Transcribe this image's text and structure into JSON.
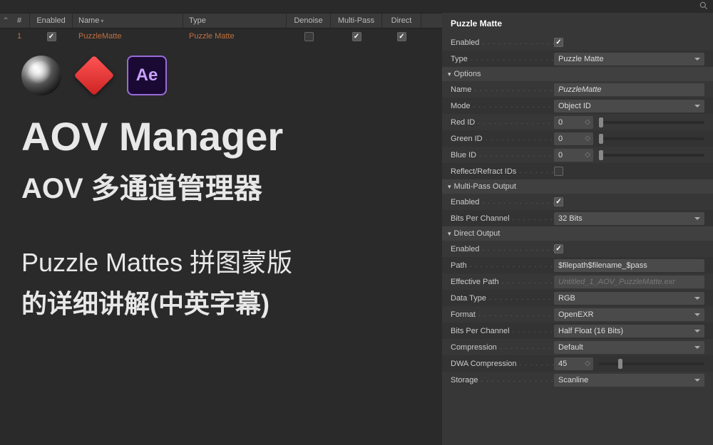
{
  "table": {
    "headers": {
      "idx": "#",
      "enabled": "Enabled",
      "name": "Name",
      "type": "Type",
      "denoise": "Denoise",
      "multipass": "Multi-Pass",
      "direct": "Direct"
    },
    "row": {
      "idx": "1",
      "name": "PuzzleMatte",
      "type": "Puzzle Matte"
    }
  },
  "promo": {
    "ae_text": "Ae",
    "title_en": "AOV Manager",
    "title_cn": "AOV 多通道管理器",
    "subtitle_1": "Puzzle Mattes 拼图蒙版",
    "subtitle_2": "的详细讲解(中英字幕)"
  },
  "panel": {
    "title": "Puzzle Matte",
    "enabled_label": "Enabled",
    "type_label": "Type",
    "type_value": "Puzzle Matte",
    "options_header": "Options",
    "name_label": "Name",
    "name_value": "PuzzleMatte",
    "mode_label": "Mode",
    "mode_value": "Object ID",
    "red_label": "Red ID",
    "red_value": "0",
    "green_label": "Green ID",
    "green_value": "0",
    "blue_label": "Blue ID",
    "blue_value": "0",
    "reflect_label": "Reflect/Refract IDs",
    "multipass_header": "Multi-Pass Output",
    "mp_enabled_label": "Enabled",
    "mp_bits_label": "Bits Per Channel",
    "mp_bits_value": "32 Bits",
    "direct_header": "Direct Output",
    "do_enabled_label": "Enabled",
    "do_path_label": "Path",
    "do_path_value": "$filepath$filename_$pass",
    "do_effpath_label": "Effective Path",
    "do_effpath_value": "Untitled_1_AOV_PuzzleMatte.exr",
    "do_datatype_label": "Data Type",
    "do_datatype_value": "RGB",
    "do_format_label": "Format",
    "do_format_value": "OpenEXR",
    "do_bits_label": "Bits Per Channel",
    "do_bits_value": "Half Float (16 Bits)",
    "do_comp_label": "Compression",
    "do_comp_value": "Default",
    "do_dwa_label": "DWA Compression",
    "do_dwa_value": "45",
    "do_storage_label": "Storage",
    "do_storage_value": "Scanline"
  }
}
